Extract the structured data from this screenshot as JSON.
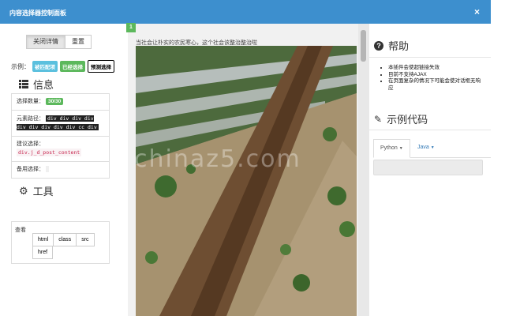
{
  "window": {
    "title": "内容选择器控制面板",
    "close": "×"
  },
  "left": {
    "buttons": {
      "close_detail": "关闭详情",
      "reset": "重置"
    },
    "example_label": "示例：",
    "chips": {
      "match": "被匹配项",
      "selected": "已经选择",
      "predict": "预测选择"
    },
    "info_heading": "信息",
    "info": {
      "count_label": "选择数量：",
      "count_value": "30/30",
      "path_label": "元素路径：",
      "path_value": "div div div div div div div div div cc div",
      "suggest_label": "建议选择：",
      "suggest_value": "div.j_d_post_content",
      "backup_label": "备用选择："
    },
    "tools_heading": "工具",
    "tools_label": "查看",
    "tools": [
      "html",
      "class",
      "src",
      "href"
    ]
  },
  "center": {
    "badge": "1",
    "caption": "当社会让朴实的农民寒心，这个社会该整治整治啦",
    "watermark": "chinaz5.com"
  },
  "right": {
    "help_heading": "帮助",
    "help_items": [
      "本插件会使超链接失效",
      "目前不支持AJAX",
      "在页面复杂的情况下可能会使对话框无响应"
    ],
    "code_heading": "示例代码",
    "tabs": [
      "Python",
      "Java"
    ]
  },
  "colors": {
    "title_bar": "#3d8fce",
    "chip_blue": "#5bc0de",
    "chip_green": "#5cb85c"
  },
  "icons": [
    "close-icon",
    "list-icon",
    "gear-icon",
    "question-circle-icon",
    "pencil-icon",
    "caret-down-icon"
  ]
}
